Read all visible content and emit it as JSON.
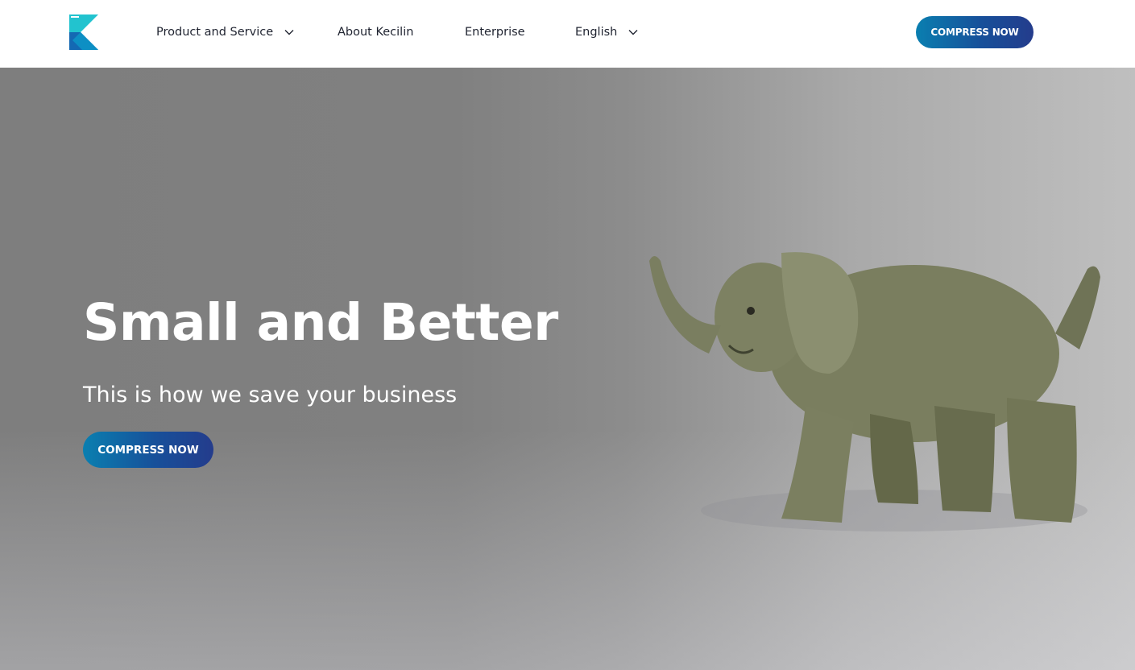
{
  "header": {
    "nav": [
      {
        "label": "Product and Service",
        "icon": "chevron-down-icon"
      },
      {
        "label": "About Kecilin"
      },
      {
        "label": "Enterprise"
      },
      {
        "label": "English",
        "icon": "chevron-down-icon"
      }
    ],
    "cta_label": "COMPRESS NOW"
  },
  "hero": {
    "title": "Small and Better",
    "subtitle": "This is how we save your business",
    "cta_label": "COMPRESS NOW"
  },
  "colors": {
    "accent_start": "#0a7fb0",
    "accent_end": "#243c8c",
    "nav_text": "#1f2330"
  }
}
